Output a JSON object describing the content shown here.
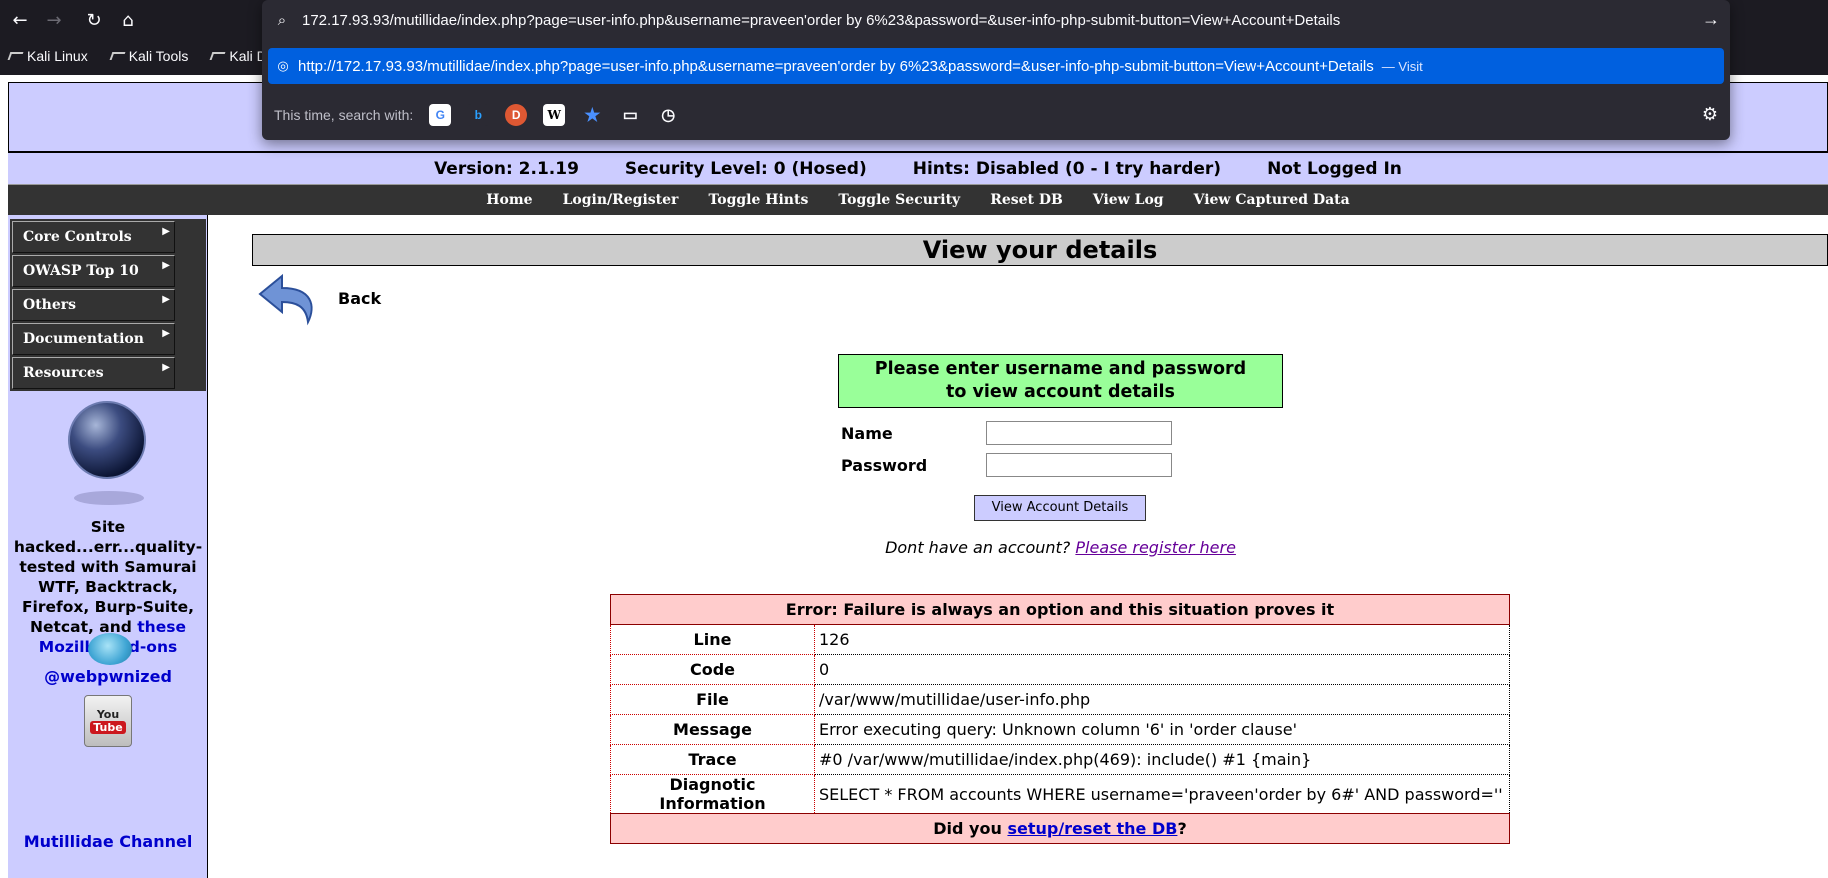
{
  "browser": {
    "url_typed": "172.17.93.93/mutillidae/index.php?page=user-info.php&username=praveen'order by 6%23&password=&user-info-php-submit-button=View+Account+Details",
    "url_suggestion": "http://172.17.93.93/mutillidae/index.php?page=user-info.php&username=praveen'order by 6%23&password=&user-info-php-submit-button=View+Account+Details",
    "suggestion_action": "— Visit",
    "search_with_label": "This time, search with:",
    "bookmarks": [
      "Kali Linux",
      "Kali Tools",
      "Kali Do"
    ]
  },
  "status": {
    "version": "Version: 2.1.19",
    "security": "Security Level: 0 (Hosed)",
    "hints": "Hints: Disabled (0 - I try harder)",
    "login": "Not Logged In"
  },
  "menu": [
    "Home",
    "Login/Register",
    "Toggle Hints",
    "Toggle Security",
    "Reset DB",
    "View Log",
    "View Captured Data"
  ],
  "sidebar": {
    "items": [
      "Core Controls",
      "OWASP Top 10",
      "Others",
      "Documentation",
      "Resources"
    ],
    "hacked_text": "Site hacked...err...quality-tested with Samurai WTF, Backtrack, Firefox, Burp-Suite, Netcat, and",
    "hacked_link": "these Mozilla Add-ons",
    "twitter": "@webpwnized",
    "youtube_you": "You",
    "youtube_tube": "Tube",
    "channel": "Mutillidae Channel"
  },
  "main": {
    "title": "View your details",
    "back": "Back",
    "form_header_line1": "Please enter username and password",
    "form_header_line2": "to view account details",
    "name_label": "Name",
    "password_label": "Password",
    "name_value": "",
    "password_value": "",
    "submit_label": "View Account Details",
    "register_prefix": "Dont have an account?",
    "register_link": "Please register here"
  },
  "error": {
    "header": "Error: Failure is always an option and this situation proves it",
    "rows": [
      {
        "label": "Line",
        "value": "126"
      },
      {
        "label": "Code",
        "value": "0"
      },
      {
        "label": "File",
        "value": "/var/www/mutillidae/user-info.php"
      },
      {
        "label": "Message",
        "value": "Error executing query: Unknown column '6' in 'order clause'"
      },
      {
        "label": "Trace",
        "value": "#0 /var/www/mutillidae/index.php(469): include() #1 {main}"
      },
      {
        "label": "Diagnotic Information",
        "value": "SELECT * FROM accounts WHERE username='praveen'order by 6#' AND password=''"
      }
    ],
    "footer_prefix": "Did you",
    "footer_link": "setup/reset the DB",
    "footer_suffix": "?"
  },
  "colors": {
    "chrome_bg": "#1c1b22",
    "suggestion_bg": "#0060df",
    "page_accent": "#ccccff",
    "form_header_bg": "#99ff99",
    "error_bg": "#ffcccc"
  }
}
